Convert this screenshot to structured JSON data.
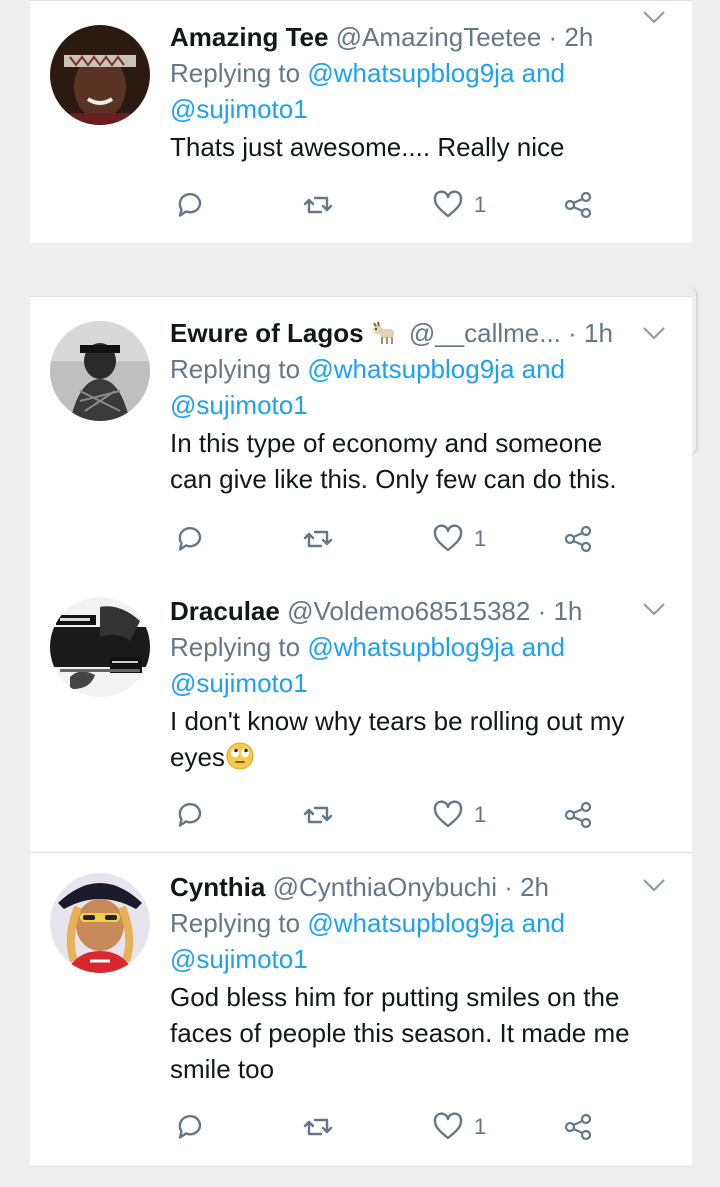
{
  "tweets": [
    {
      "display_name": "Amazing Tee",
      "handle": "@AmazingTeetee",
      "time": "· 2h",
      "reply_prefix": "Replying to",
      "reply_user1": "@whatsupblog9ja",
      "reply_and": "and",
      "reply_user2": "@sujimoto1",
      "text_lines": [
        "Thats just awesome.... Really nice"
      ],
      "likes": "1"
    },
    {
      "display_name": "Ewure of Lagos",
      "name_emoji": "goat-emoji",
      "handle": "@__callme...",
      "time": "· 1h",
      "reply_prefix": "Replying to",
      "reply_user1": "@whatsupblog9ja",
      "reply_and": "and",
      "reply_user2": "@sujimoto1",
      "text_lines": [
        "In this type of economy and someone",
        "can give like this. Only few can do this."
      ],
      "likes": "1"
    },
    {
      "display_name": "Draculae",
      "handle": "@Voldemo68515382",
      "time": "· 1h",
      "reply_prefix": "Replying to",
      "reply_user1": "@whatsupblog9ja",
      "reply_and": "and",
      "reply_user2": "@sujimoto1",
      "text_lines": [
        "I don't know why tears be rolling out my",
        "eyes"
      ],
      "text_emoji": "face-with-rolling-eyes-emoji",
      "likes": "1"
    },
    {
      "display_name": "Cynthia",
      "handle": "@CynthiaOnybuchi",
      "time": "· 2h",
      "reply_prefix": "Replying to",
      "reply_user1": "@whatsupblog9ja",
      "reply_and": "and",
      "reply_user2": "@sujimoto1",
      "text_lines": [
        "God bless him for putting smiles on the",
        "faces of people this season. It made me",
        "smile too"
      ],
      "likes": "1"
    }
  ],
  "colors": {
    "link": "#1da1f2",
    "secondary_text": "#657786",
    "primary_text": "#14171a"
  }
}
